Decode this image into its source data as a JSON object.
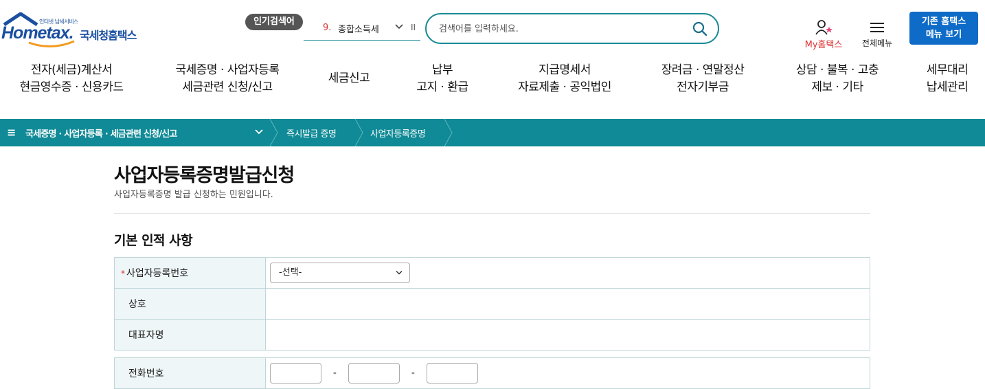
{
  "header": {
    "logo_small": "인터넷 납세서비스",
    "logo_brand": "Hometax.",
    "logo_kr": "국세청홈택스",
    "popular_badge": "인기검색어",
    "popular_num": "9.",
    "popular_word": "종합소득세",
    "pause_label": "II",
    "search_placeholder": "검색어를 입력하세요.",
    "my_label": "My홈택스",
    "allmenu_label": "전체메뉴",
    "oldmenu_line1": "기존 홈택스",
    "oldmenu_line2": "메뉴 보기"
  },
  "gnb": [
    {
      "line1": "전자(세금)계산서",
      "line2": "현금영수증 · 신용카드"
    },
    {
      "line1": "국세증명 · 사업자등록",
      "line2": "세금관련 신청/신고"
    },
    {
      "line1": "세금신고",
      "line2": ""
    },
    {
      "line1": "납부",
      "line2": "고지 · 환급"
    },
    {
      "line1": "지급명세서",
      "line2": "자료제출 · 공익법인"
    },
    {
      "line1": "장려금 · 연말정산",
      "line2": "전자기부금"
    },
    {
      "line1": "상담 · 불복 · 고충",
      "line2": "제보 · 기타"
    },
    {
      "line1": "세무대리",
      "line2": "납세관리"
    }
  ],
  "breadcrumb": {
    "menu_icon": "≡",
    "level1": "국세증명 · 사업자등록 · 세금관련 신청/신고",
    "level2": "즉시발급 증명",
    "level3": "사업자등록증명"
  },
  "page": {
    "title": "사업자등록증명발급신청",
    "description": "사업자등록증명 발급 신청하는 민원입니다.",
    "section_title": "기본 인적 사항"
  },
  "form": {
    "required_mark": "*",
    "bizno_label": "사업자등록번호",
    "bizno_select": "-선택-",
    "company_label": "상호",
    "ceo_label": "대표자명",
    "phone_label": "전화번호",
    "phone_dash": "-"
  },
  "colors": {
    "brand_blue": "#1a4fa0",
    "teal": "#0f8a96",
    "accent_red": "#d33333",
    "button_blue": "#0e6bc7"
  }
}
